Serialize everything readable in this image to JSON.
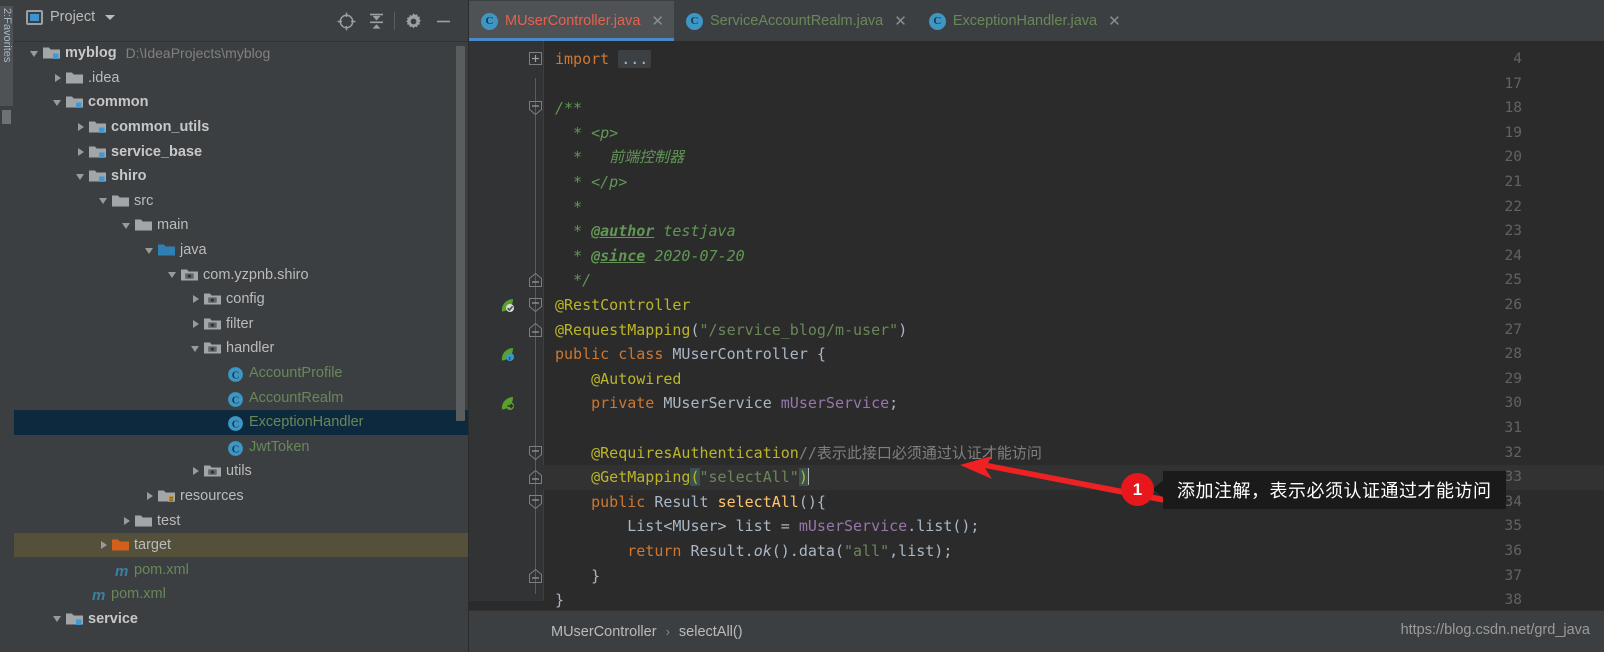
{
  "left_strip": {
    "vertical_tab": "2:Favorites"
  },
  "project_panel": {
    "title": "Project",
    "icons": [
      "project-icon",
      "chevron-down-icon",
      "locate-icon",
      "collapse-all-icon",
      "gear-icon",
      "minimize-icon"
    ],
    "tree": [
      {
        "depth": 0,
        "twisty": "down",
        "icon": "module-folder",
        "label": "myblog",
        "bold": true,
        "path": "D:\\IdeaProjects\\myblog"
      },
      {
        "depth": 1,
        "twisty": "right",
        "icon": "folder",
        "label": ".idea",
        "bold": false
      },
      {
        "depth": 1,
        "twisty": "down",
        "icon": "module-folder",
        "label": "common",
        "bold": true
      },
      {
        "depth": 2,
        "twisty": "right",
        "icon": "module-folder",
        "label": "common_utils",
        "bold": true
      },
      {
        "depth": 2,
        "twisty": "right",
        "icon": "module-folder",
        "label": "service_base",
        "bold": true
      },
      {
        "depth": 2,
        "twisty": "down",
        "icon": "module-folder",
        "label": "shiro",
        "bold": true
      },
      {
        "depth": 3,
        "twisty": "down",
        "icon": "folder",
        "label": "src",
        "bold": false
      },
      {
        "depth": 4,
        "twisty": "down",
        "icon": "folder",
        "label": "main",
        "bold": false
      },
      {
        "depth": 5,
        "twisty": "down",
        "icon": "source-folder",
        "label": "java",
        "bold": false
      },
      {
        "depth": 6,
        "twisty": "down",
        "icon": "package",
        "label": "com.yzpnb.shiro",
        "bold": false
      },
      {
        "depth": 7,
        "twisty": "right",
        "icon": "package",
        "label": "config",
        "bold": false
      },
      {
        "depth": 7,
        "twisty": "right",
        "icon": "package",
        "label": "filter",
        "bold": false
      },
      {
        "depth": 7,
        "twisty": "down",
        "icon": "package",
        "label": "handler",
        "bold": false
      },
      {
        "depth": 8,
        "twisty": "none",
        "icon": "java-class",
        "label": "AccountProfile",
        "green": true
      },
      {
        "depth": 8,
        "twisty": "none",
        "icon": "java-class",
        "label": "AccountRealm",
        "green": true
      },
      {
        "depth": 8,
        "twisty": "none",
        "icon": "java-class",
        "label": "ExceptionHandler",
        "green": true,
        "selected": true
      },
      {
        "depth": 8,
        "twisty": "none",
        "icon": "java-class",
        "label": "JwtToken",
        "green": true
      },
      {
        "depth": 7,
        "twisty": "right",
        "icon": "package",
        "label": "utils",
        "bold": false
      },
      {
        "depth": 5,
        "twisty": "right",
        "icon": "resource-folder",
        "label": "resources",
        "bold": false
      },
      {
        "depth": 4,
        "twisty": "right",
        "icon": "folder",
        "label": "test",
        "bold": false
      },
      {
        "depth": 3,
        "twisty": "right",
        "icon": "target-folder",
        "label": "target",
        "bold": false,
        "highlight": true
      },
      {
        "depth": 3,
        "twisty": "none",
        "icon": "maven-file",
        "label": "pom.xml",
        "green": true
      },
      {
        "depth": 2,
        "twisty": "none",
        "icon": "maven-file",
        "label": "pom.xml",
        "green": true
      },
      {
        "depth": 1,
        "twisty": "down",
        "icon": "module-folder",
        "label": "service",
        "bold": true
      }
    ]
  },
  "editor": {
    "tabs": [
      {
        "label": "MUserController.java",
        "active": true
      },
      {
        "label": "ServiceAccountRealm.java",
        "active": false
      },
      {
        "label": "ExceptionHandler.java",
        "active": false
      }
    ],
    "close_glyph": "✕",
    "class_icon_letter": "C",
    "line_numbers": [
      "4",
      "17",
      "18",
      "19",
      "20",
      "21",
      "22",
      "23",
      "24",
      "25",
      "26",
      "27",
      "28",
      "29",
      "30",
      "31",
      "32",
      "33",
      "34",
      "35",
      "36",
      "37",
      "38"
    ],
    "current_line": "33",
    "fold_placeholder": "...",
    "code_lines": [
      {
        "n": "4",
        "tokens": [
          {
            "t": "import ",
            "c": "kw"
          },
          {
            "t": "...",
            "c": "fold"
          }
        ]
      },
      {
        "n": "17",
        "tokens": []
      },
      {
        "n": "18",
        "tokens": [
          {
            "t": "/**",
            "c": "doc"
          }
        ]
      },
      {
        "n": "19",
        "tokens": [
          {
            "t": "  * <p>",
            "c": "doc"
          }
        ]
      },
      {
        "n": "20",
        "tokens": [
          {
            "t": "  *   前端控制器",
            "c": "doc"
          }
        ]
      },
      {
        "n": "21",
        "tokens": [
          {
            "t": "  * </p>",
            "c": "doc"
          }
        ]
      },
      {
        "n": "22",
        "tokens": [
          {
            "t": "  *",
            "c": "doc"
          }
        ]
      },
      {
        "n": "23",
        "tokens": [
          {
            "t": "  * ",
            "c": "doc"
          },
          {
            "t": "@author",
            "c": "tag"
          },
          {
            "t": " testjava",
            "c": "doc"
          }
        ]
      },
      {
        "n": "24",
        "tokens": [
          {
            "t": "  * ",
            "c": "doc"
          },
          {
            "t": "@since",
            "c": "tag"
          },
          {
            "t": " 2020-07-20",
            "c": "doc"
          }
        ]
      },
      {
        "n": "25",
        "tokens": [
          {
            "t": "  */",
            "c": "doc"
          }
        ]
      },
      {
        "n": "26",
        "tokens": [
          {
            "t": "@RestController",
            "c": "ann"
          }
        ]
      },
      {
        "n": "27",
        "tokens": [
          {
            "t": "@RequestMapping",
            "c": "ann"
          },
          {
            "t": "(",
            "c": "txt"
          },
          {
            "t": "\"/service_blog/m-user\"",
            "c": "str"
          },
          {
            "t": ")",
            "c": "txt"
          }
        ]
      },
      {
        "n": "28",
        "tokens": [
          {
            "t": "public class ",
            "c": "kw"
          },
          {
            "t": "MUserController ",
            "c": "txt"
          },
          {
            "t": "{",
            "c": "txt"
          }
        ]
      },
      {
        "n": "29",
        "tokens": [
          {
            "t": "    @Autowired",
            "c": "ann"
          }
        ]
      },
      {
        "n": "30",
        "tokens": [
          {
            "t": "    private ",
            "c": "kw"
          },
          {
            "t": "MUserService ",
            "c": "txt"
          },
          {
            "t": "mUserService",
            "c": "fld"
          },
          {
            "t": ";",
            "c": "txt"
          }
        ]
      },
      {
        "n": "31",
        "tokens": []
      },
      {
        "n": "32",
        "tokens": [
          {
            "t": "    @RequiresAuthentication",
            "c": "ann"
          },
          {
            "t": "//表示此接口必须通过认证才能访问",
            "c": "gcmt"
          }
        ]
      },
      {
        "n": "33",
        "tokens": [
          {
            "t": "    @GetMapping",
            "c": "ann"
          },
          {
            "t": "(",
            "c": "brk"
          },
          {
            "t": "\"selectAll\"",
            "c": "str"
          },
          {
            "t": ")",
            "c": "brk"
          }
        ]
      },
      {
        "n": "34",
        "tokens": [
          {
            "t": "    public ",
            "c": "kw"
          },
          {
            "t": "Result ",
            "c": "txt"
          },
          {
            "t": "selectAll",
            "c": "mth"
          },
          {
            "t": "(){",
            "c": "txt"
          }
        ]
      },
      {
        "n": "35",
        "tokens": [
          {
            "t": "        List<MUser> list = ",
            "c": "txt"
          },
          {
            "t": "mUserService",
            "c": "fld"
          },
          {
            "t": ".list();",
            "c": "txt"
          }
        ]
      },
      {
        "n": "36",
        "tokens": [
          {
            "t": "        return ",
            "c": "kw"
          },
          {
            "t": "Result.",
            "c": "txt"
          },
          {
            "t": "ok",
            "c": "italic"
          },
          {
            "t": "().data(",
            "c": "txt"
          },
          {
            "t": "\"all\"",
            "c": "str"
          },
          {
            "t": ",list);",
            "c": "txt"
          }
        ]
      },
      {
        "n": "37",
        "tokens": [
          {
            "t": "    }",
            "c": "txt"
          }
        ]
      },
      {
        "n": "38",
        "tokens": [
          {
            "t": "}",
            "c": "txt"
          }
        ]
      }
    ],
    "gutter_markers": [
      {
        "line": "26",
        "icon": "spring-bean-check-icon"
      },
      {
        "line": "28",
        "icon": "spring-bean-class-icon"
      },
      {
        "line": "30",
        "icon": "spring-bean-autowired-icon"
      }
    ],
    "breadcrumb": {
      "parts": [
        "MUserController",
        "selectAll()"
      ],
      "separator": "›"
    },
    "watermark": "https://blog.csdn.net/grd_java"
  },
  "annotation": {
    "badge_number": "1",
    "text": "添加注解，表示必须认证通过才能访问",
    "arrow_color": "#ee2222",
    "badge_color": "#e8171b",
    "box_color": "#1a1a1a"
  }
}
